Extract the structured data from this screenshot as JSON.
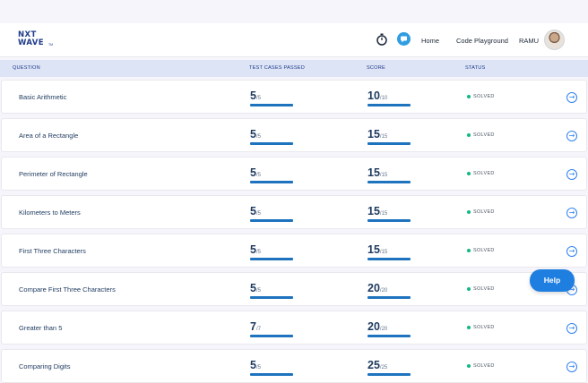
{
  "brand": {
    "line1": "NXT",
    "line2": "WAVE",
    "tm": "TM"
  },
  "nav": {
    "home": "Home",
    "code_playground": "Code Playground",
    "user": "RAMU"
  },
  "icons": {
    "timer": "timer-icon",
    "chat": "chat-icon",
    "arrow": "arrow-right-circle-icon"
  },
  "table": {
    "headers": {
      "question": "QUESTION",
      "test_cases": "TEST CASES PASSED",
      "score": "SCORE",
      "status": "STATUS"
    },
    "rows": [
      {
        "question": "Basic Arithmetic",
        "passed": "5",
        "total": "/5",
        "score": "10",
        "max": "/10",
        "status": "SOLVED"
      },
      {
        "question": "Area of a Rectangle",
        "passed": "5",
        "total": "/5",
        "score": "15",
        "max": "/15",
        "status": "SOLVED"
      },
      {
        "question": "Perimeter of Rectangle",
        "passed": "5",
        "total": "/5",
        "score": "15",
        "max": "/15",
        "status": "SOLVED"
      },
      {
        "question": "Kilometers to Meters",
        "passed": "5",
        "total": "/5",
        "score": "15",
        "max": "/15",
        "status": "SOLVED"
      },
      {
        "question": "First Three Characters",
        "passed": "5",
        "total": "/5",
        "score": "15",
        "max": "/15",
        "status": "SOLVED"
      },
      {
        "question": "Compare First Three Characters",
        "passed": "5",
        "total": "/5",
        "score": "20",
        "max": "/20",
        "status": "SOLVED"
      },
      {
        "question": "Greater than 5",
        "passed": "7",
        "total": "/7",
        "score": "20",
        "max": "/20",
        "status": "SOLVED"
      },
      {
        "question": "Comparing Digits",
        "passed": "5",
        "total": "/5",
        "score": "25",
        "max": "/25",
        "status": "SOLVED"
      }
    ]
  },
  "help": {
    "label": "Help"
  },
  "colors": {
    "accent": "#1f7fe0",
    "solved": "#10b981",
    "header_bg": "#dde4f6"
  }
}
